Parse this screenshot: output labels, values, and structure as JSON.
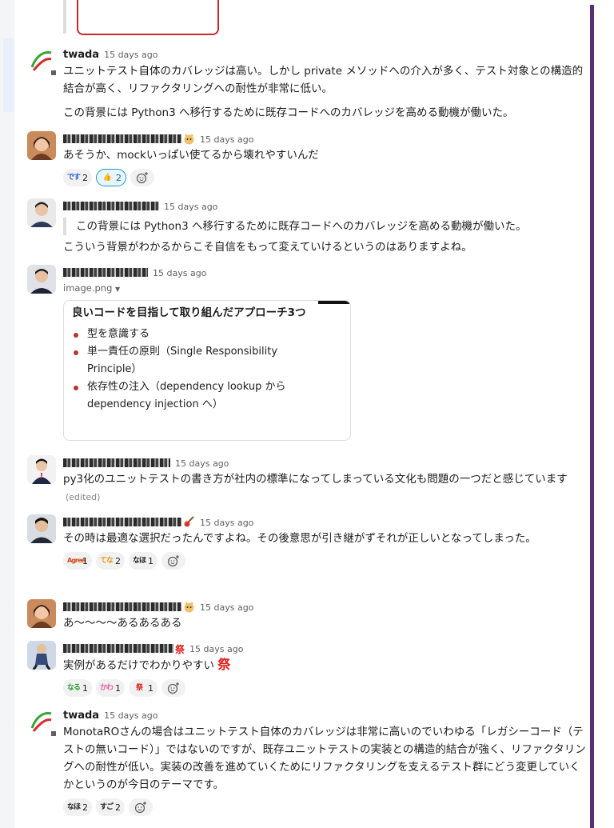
{
  "colors": {
    "accent": "#1264a3",
    "sidebar_bar": "#5b2c6f",
    "timestamp": "#616061",
    "bullet": "#b5362b"
  },
  "messages": [
    {
      "author": "twada",
      "time": "15 days ago",
      "avatar": "twada-logo",
      "paragraphs": [
        "ユニットテスト自体のカバレッジは高い。しかし private メソッドへの介入が多く、テスト対象との構造的結合が高く、リファクタリングへの耐性が非常に低い。",
        "この背景には Python3 へ移行するために既存コードへのカバレッジを高める動機が働いた。"
      ]
    },
    {
      "time": "15 days ago",
      "text": "あそうか、mockいっぱい使てるから壊れやすいんだ",
      "reactions": [
        {
          "icon": "desu-emoji",
          "glyph": "です",
          "count": "2"
        },
        {
          "icon": "thumbs-up-icon",
          "glyph": "👍",
          "count": "2",
          "active": true
        }
      ]
    },
    {
      "time": "15 days ago",
      "quote": "この背景には Python3 へ移行するために既存コードへのカバレッジを高める動機が働いた。",
      "text": "こういう背景がわかるからこそ自信をもって変えていけるというのはありますよね。"
    },
    {
      "time": "15 days ago",
      "file_label": "image.png",
      "preview_title": "良いコードを目指して取り組んだアプローチ3つ",
      "preview_items": [
        "型を意識する",
        "単一責任の原則（Single Responsibility Principle）",
        "依存性の注入（dependency lookup から dependency injection へ）"
      ]
    },
    {
      "time": "15 days ago",
      "text": "py3化のユニットテストの書き方が社内の標準になってしまっている文化も問題の一つだと感じています",
      "edited": "(edited)"
    },
    {
      "time": "15 days ago",
      "text": "その時は最適な選択だったんですよね。その後意思が引き継がずそれが正しいとなってしまった。",
      "reactions": [
        {
          "icon": "agree-emoji",
          "glyph": "Agree",
          "count": "1"
        },
        {
          "icon": "wakaru-emoji",
          "glyph": "てな",
          "count": "2"
        },
        {
          "icon": "naruhodo-emoji",
          "glyph": "なほ",
          "count": "1"
        }
      ]
    },
    {
      "time": "15 days ago",
      "text": "あ〜〜〜〜あるあるある"
    },
    {
      "time": "15 days ago",
      "text": "実例があるだけでわかりやすい",
      "inline_emoji": "祭",
      "reactions": [
        {
          "icon": "green-emoji",
          "glyph": "なる",
          "count": "1"
        },
        {
          "icon": "pink-emoji",
          "glyph": "かわ",
          "count": "1"
        },
        {
          "icon": "matsuri-emoji",
          "glyph": "祭",
          "count": "1"
        }
      ]
    },
    {
      "author": "twada",
      "time": "15 days ago",
      "text": "MonotaROさんの場合はユニットテスト自体のカバレッジは非常に高いのでいわゆる「レガシーコード（テストの無いコード）」ではないのですが、既存ユニットテストの実装との構造的結合が強く、リファクタリングへの耐性が低い。実装の改善を進めていくためにリファクタリングを支えるテスト群にどう変更していくかというのが今日のテーマです。",
      "reactions": [
        {
          "icon": "naruhodo-emoji",
          "glyph": "なほ",
          "count": "2"
        },
        {
          "icon": "sugoi-emoji",
          "glyph": "すご",
          "count": "2"
        }
      ]
    }
  ]
}
